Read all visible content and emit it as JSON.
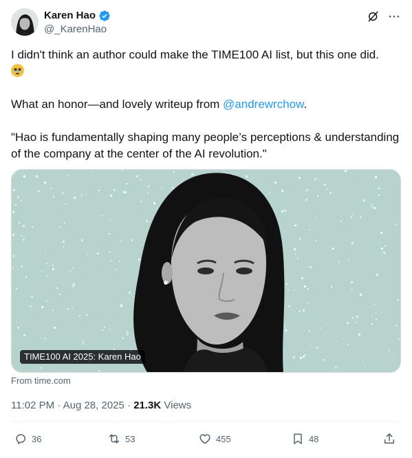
{
  "author": {
    "name": "Karen Hao",
    "handle": "@_KarenHao",
    "verified_icon": "verified-badge-icon"
  },
  "top_icons": [
    "grok-icon",
    "more-icon"
  ],
  "tweet": {
    "line1": "I didn't think an author could make the TIME100 AI list, but this one did.",
    "line1_emoji": "pleading-face-emoji",
    "line2_prefix": "What an honor—and lovely writeup from ",
    "mention": "@andrewrchow",
    "line2_suffix": ".",
    "quote": "\"Hao is fundamentally shaping many people’s perceptions & understanding of the company at the center of the AI revolution.\""
  },
  "card": {
    "title": "TIME100 AI 2025: Karen Hao",
    "source": "From time.com",
    "background_color": "#b6d3ce"
  },
  "meta": {
    "time": "11:02 PM",
    "separator": " · ",
    "date": "Aug 28, 2025",
    "views_count": "21.3K",
    "views_label": " Views"
  },
  "actions": {
    "replies": "36",
    "reposts": "53",
    "likes": "455",
    "bookmarks": "48"
  },
  "colors": {
    "text": "#0f1419",
    "secondary": "#536471",
    "link": "#1d9bf0",
    "verified": "#1d9bf0"
  }
}
